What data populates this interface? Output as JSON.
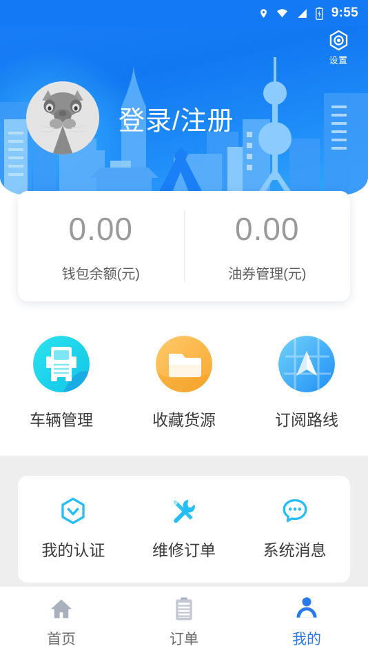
{
  "statusbar": {
    "time": "9:55",
    "icons": [
      "location-pin-icon",
      "wifi-icon",
      "signal-icon",
      "battery-icon"
    ]
  },
  "header": {
    "settings_label": "设置",
    "settings_icon": "hexagon-gear-icon",
    "login_text": "登录/注册",
    "avatar_icon": "cat-avatar",
    "accent_color": "#1479f5"
  },
  "wallet": {
    "left": {
      "amount": "0.00",
      "label": "钱包余额(元)"
    },
    "right": {
      "amount": "0.00",
      "label": "油券管理(元)"
    }
  },
  "quick_actions": [
    {
      "label": "车辆管理",
      "icon": "truck-icon",
      "color": "#16d5e8"
    },
    {
      "label": "收藏货源",
      "icon": "folder-icon",
      "color": "#fbb549"
    },
    {
      "label": "订阅路线",
      "icon": "navigation-arrow-icon",
      "color": "#36a9f7"
    }
  ],
  "tools": [
    {
      "label": "我的认证",
      "icon": "hexagon-check-icon",
      "color": "#24bdf5"
    },
    {
      "label": "维修订单",
      "icon": "wrench-screwdriver-icon",
      "color": "#24bdf5"
    },
    {
      "label": "系统消息",
      "icon": "chat-bubble-icon",
      "color": "#24bdf5"
    }
  ],
  "bottom_nav": {
    "active_color": "#2878f0",
    "inactive_color": "#a9b0bd",
    "items": [
      {
        "label": "首页",
        "icon": "home-icon",
        "active": false
      },
      {
        "label": "订单",
        "icon": "clipboard-icon",
        "active": false
      },
      {
        "label": "我的",
        "icon": "person-icon",
        "active": true
      }
    ]
  }
}
